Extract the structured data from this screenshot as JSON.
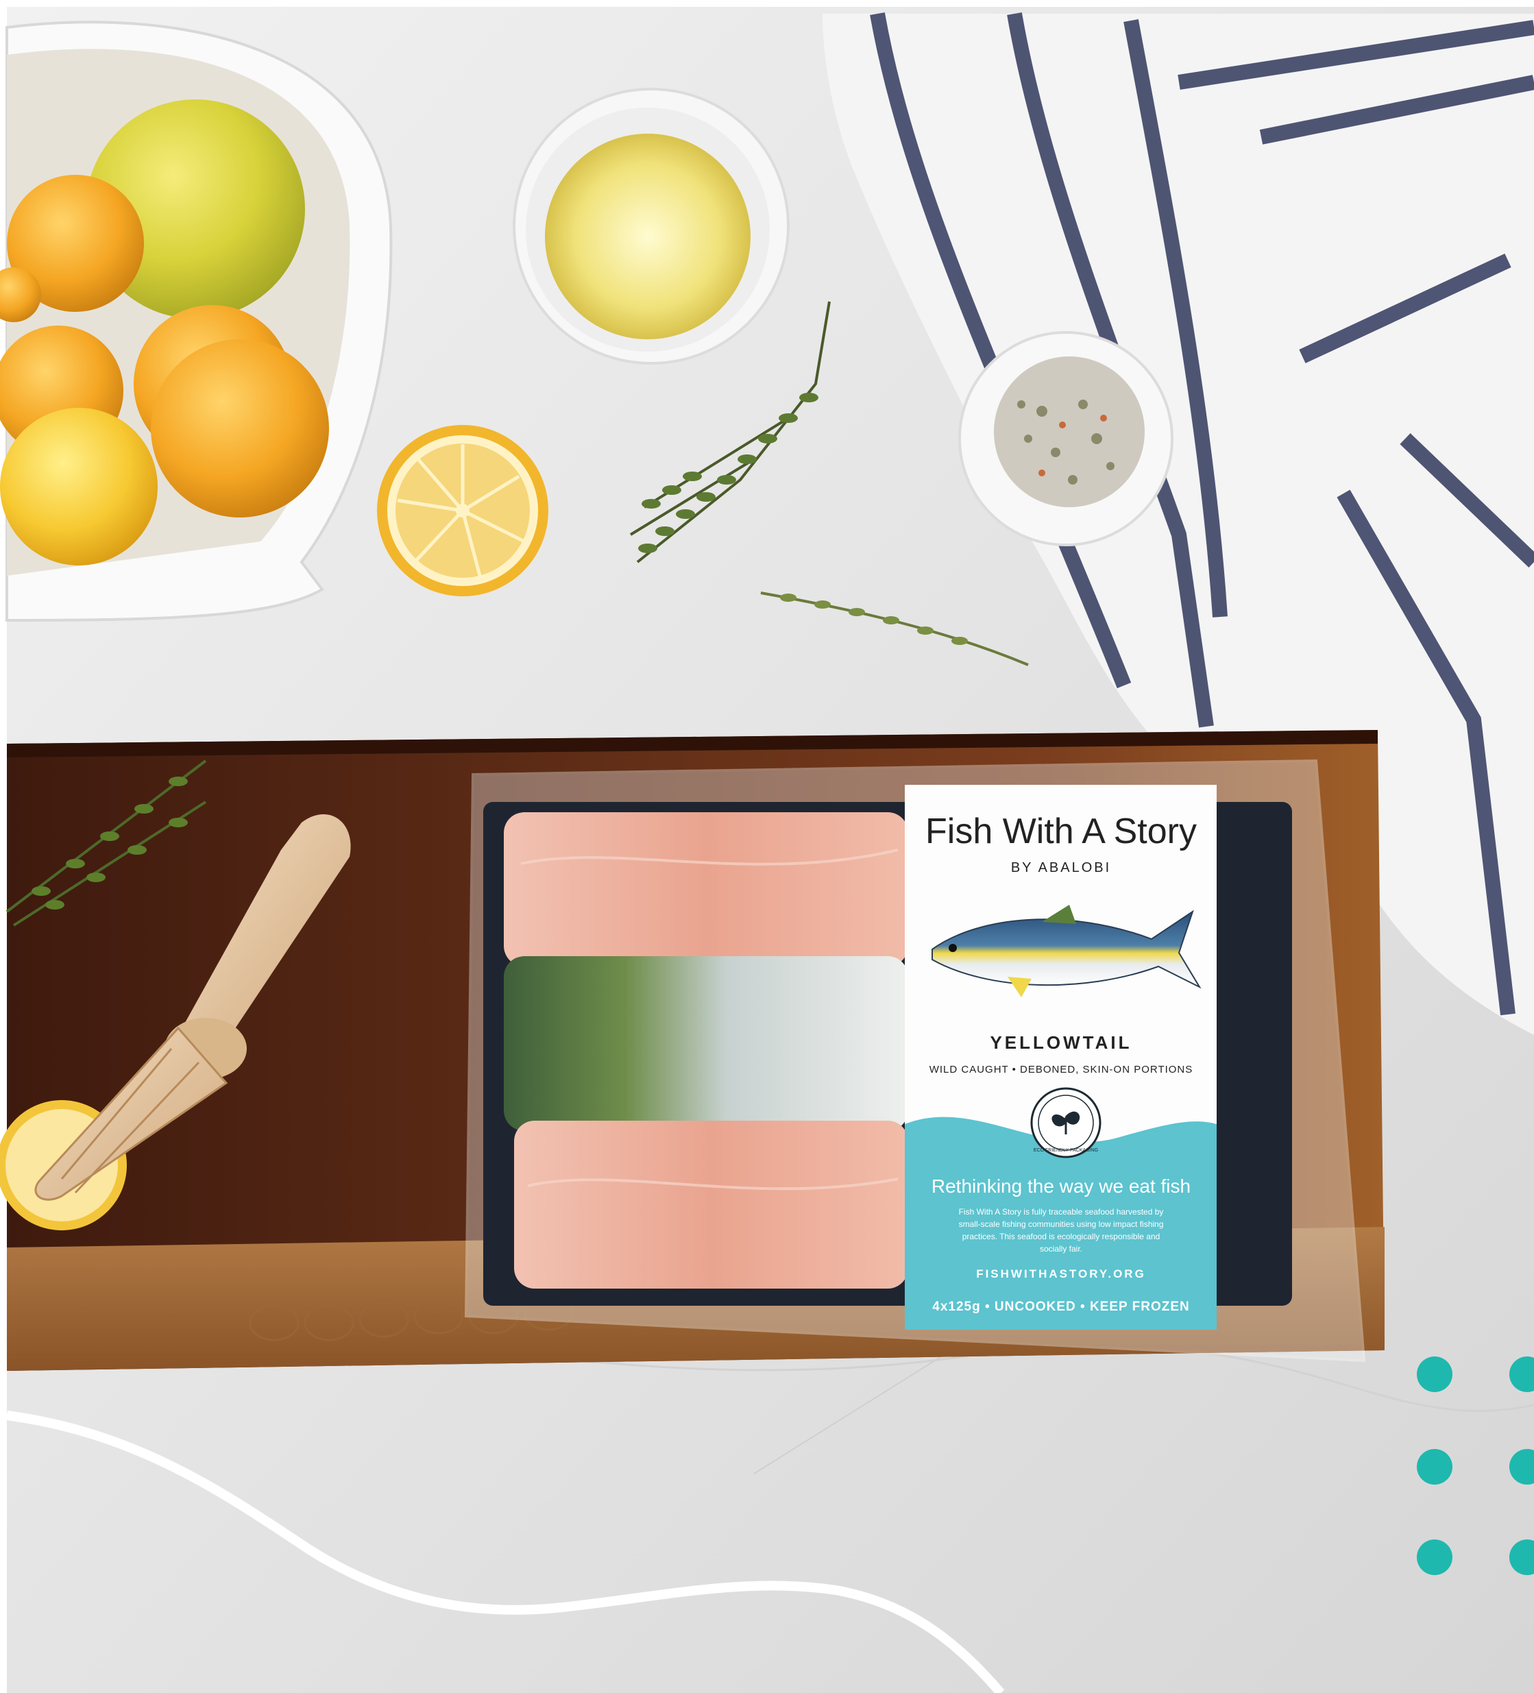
{
  "package": {
    "brand_title": "Fish With A Story",
    "brand_subtitle": "BY ABALOBI",
    "species": "YELLOWTAIL",
    "description": "WILD CAUGHT • DEBONED, SKIN-ON PORTIONS",
    "badge_text": "ECO FRIENDLY PACKAGING",
    "tagline": "Rethinking the way we eat fish",
    "body_lines": [
      "Fish With A Story is fully traceable seafood harvested by",
      "small-scale fishing communities using low impact fishing",
      "practices. This seafood is ecologically responsible and",
      "socially fair."
    ],
    "website": "FISHWITHASTORY.ORG",
    "weight_info": "4x125g • UNCOOKED • KEEP FROZEN"
  },
  "colors": {
    "accent_teal": "#1fb8ae",
    "label_teal": "#5cc3cf",
    "board_wood": "#5a2a14",
    "marble": "#e6e6e6",
    "towel_stripe": "#3d4466",
    "fish_flesh": "#e9a896"
  },
  "decorations": {
    "dots": "teal-dot-grid",
    "wave": "white-wave-line"
  }
}
